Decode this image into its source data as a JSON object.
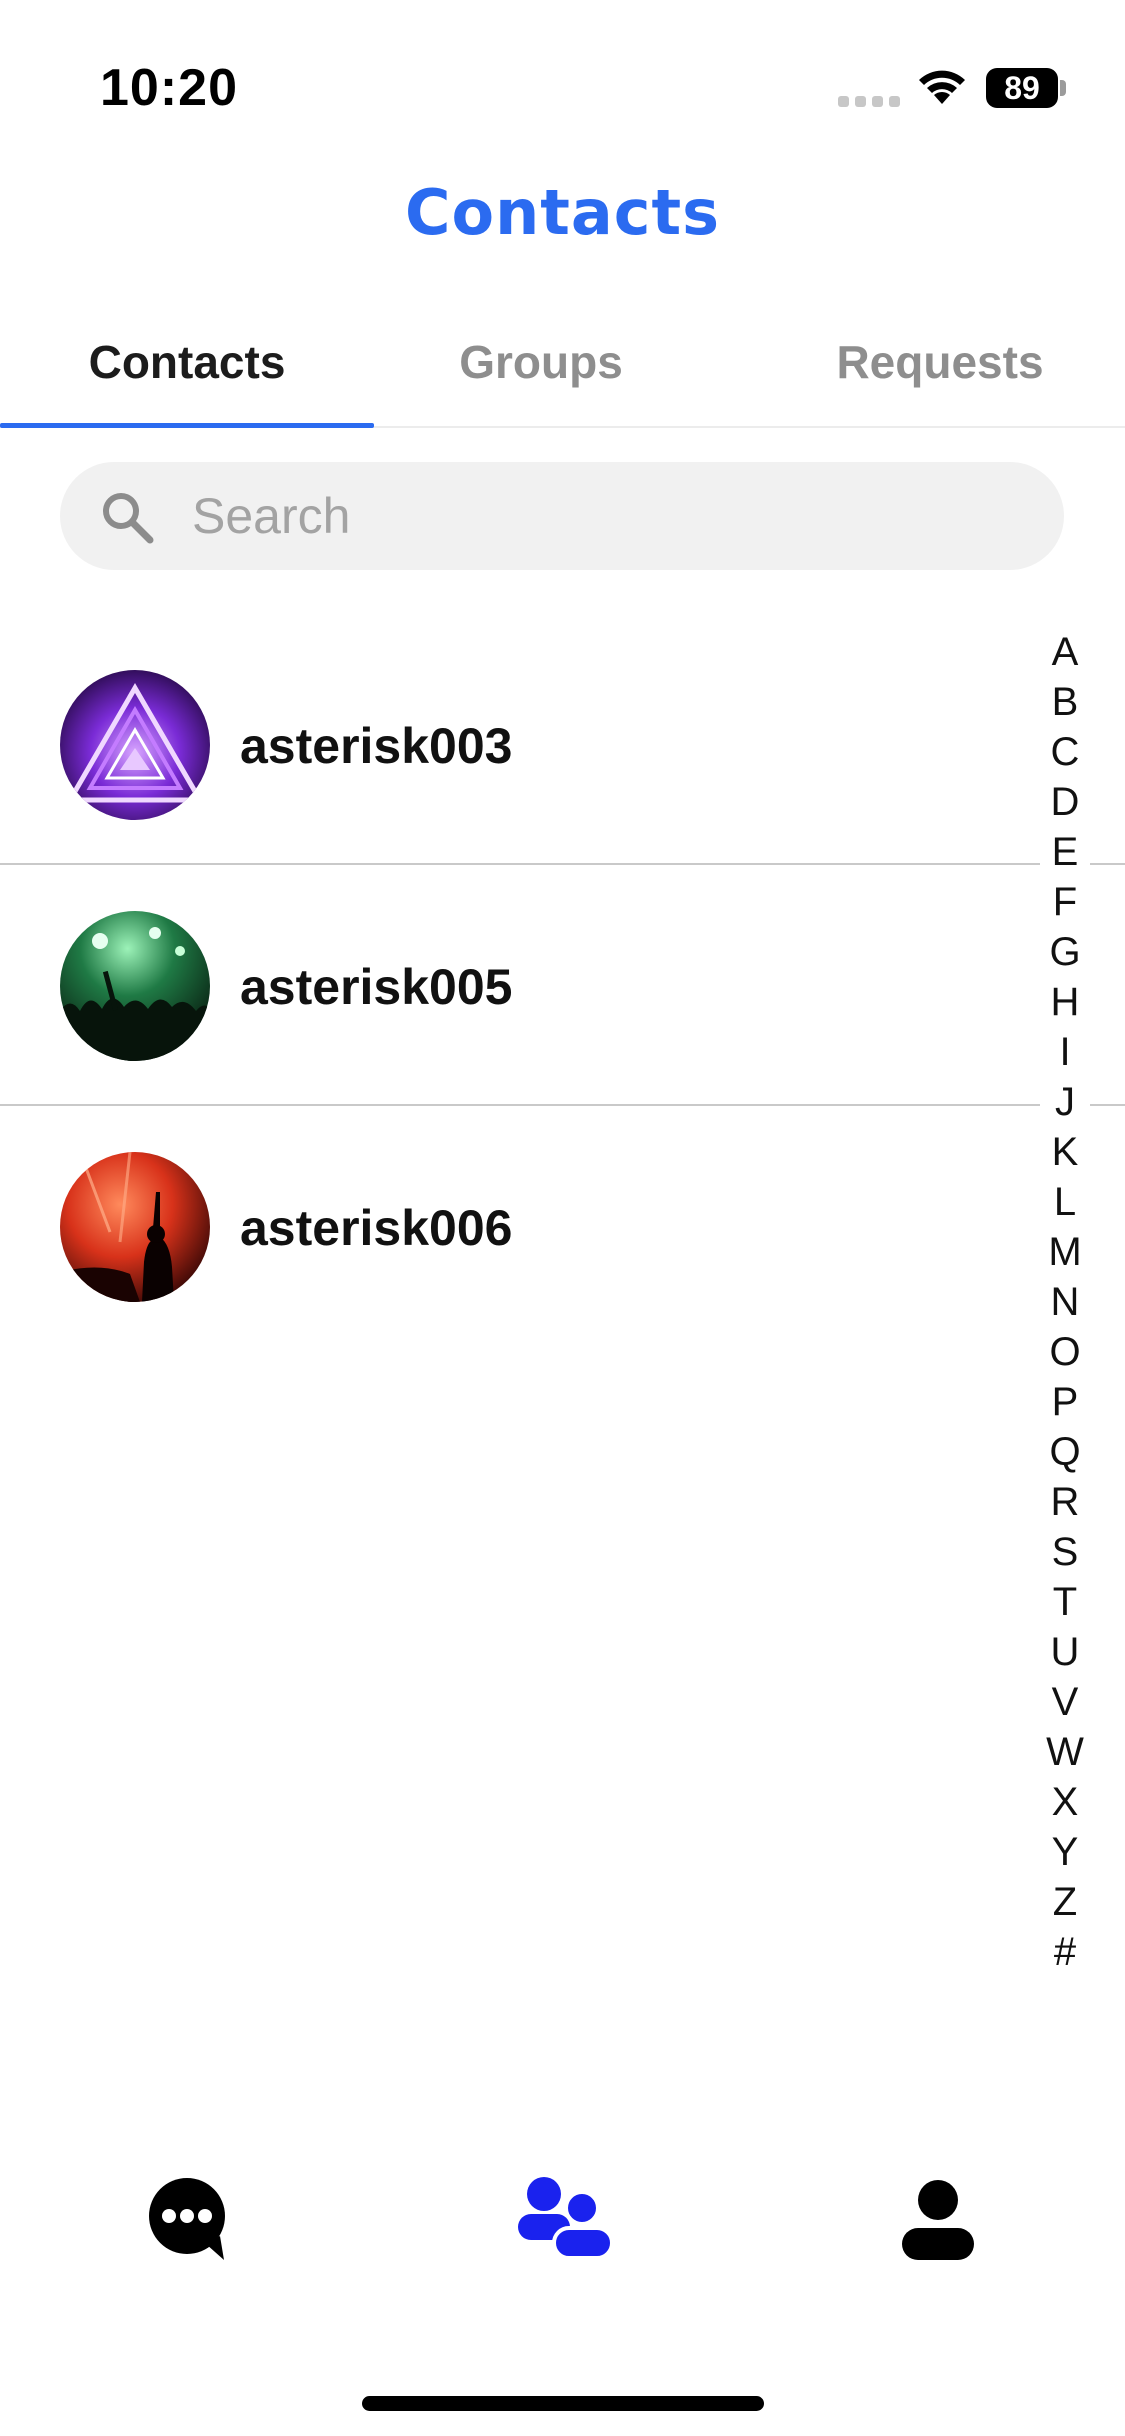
{
  "status_bar": {
    "time": "10:20",
    "battery": "89"
  },
  "header": {
    "title": "Contacts"
  },
  "tabs": [
    {
      "label": "Contacts",
      "active": true
    },
    {
      "label": "Groups",
      "active": false
    },
    {
      "label": "Requests",
      "active": false
    }
  ],
  "search": {
    "placeholder": "Search",
    "value": ""
  },
  "contacts": [
    {
      "name": "asterisk003",
      "avatar": "purple-neon-triangle-photo"
    },
    {
      "name": "asterisk005",
      "avatar": "green-concert-crowd-photo"
    },
    {
      "name": "asterisk006",
      "avatar": "red-concert-silhouette-photo"
    }
  ],
  "alphabet_index": [
    "A",
    "B",
    "C",
    "D",
    "E",
    "F",
    "G",
    "H",
    "I",
    "J",
    "K",
    "L",
    "M",
    "N",
    "O",
    "P",
    "Q",
    "R",
    "S",
    "T",
    "U",
    "V",
    "W",
    "X",
    "Y",
    "Z",
    "#"
  ],
  "bottom_nav": [
    {
      "icon": "chat-bubble-icon",
      "active": false
    },
    {
      "icon": "contacts-people-icon",
      "active": true
    },
    {
      "icon": "profile-person-icon",
      "active": false
    }
  ],
  "colors": {
    "accent": "#2b6bf0",
    "nav_active": "#1a22ee",
    "inactive_text": "#8e8e8e"
  }
}
